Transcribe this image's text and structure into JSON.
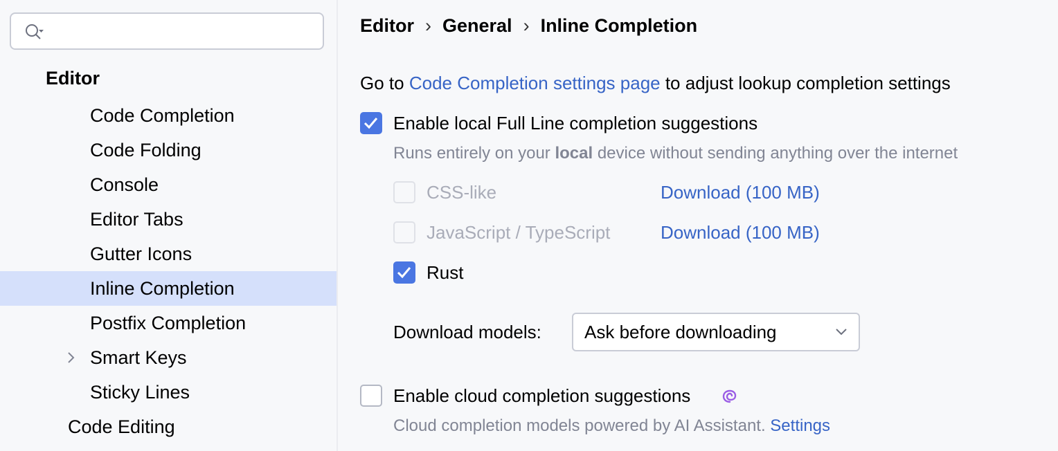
{
  "sidebar": {
    "search": {
      "value": "",
      "placeholder": ""
    },
    "section": "Editor",
    "items": [
      {
        "label": "Code Completion"
      },
      {
        "label": "Code Folding"
      },
      {
        "label": "Console"
      },
      {
        "label": "Editor Tabs"
      },
      {
        "label": "Gutter Icons"
      },
      {
        "label": "Inline Completion",
        "selected": true
      },
      {
        "label": "Postfix Completion"
      },
      {
        "label": "Smart Keys",
        "expandable": true
      },
      {
        "label": "Sticky Lines"
      }
    ],
    "next_section": "Code Editing"
  },
  "breadcrumb": {
    "items": [
      "Editor",
      "General",
      "Inline Completion"
    ],
    "separator": "›"
  },
  "main": {
    "goto_prefix": "Go to ",
    "goto_link": "Code Completion settings page",
    "goto_suffix": " to adjust lookup completion settings",
    "local": {
      "label": "Enable local Full Line completion suggestions",
      "checked": true,
      "hint_prefix": "Runs entirely on your ",
      "hint_bold": "local",
      "hint_suffix": " device without sending anything over the internet",
      "languages": [
        {
          "label": "CSS-like",
          "checked": false,
          "enabled": false,
          "download": "Download (100 MB)"
        },
        {
          "label": "JavaScript / TypeScript",
          "checked": false,
          "enabled": false,
          "download": "Download (100 MB)"
        },
        {
          "label": "Rust",
          "checked": true,
          "enabled": true
        }
      ],
      "download_models_label": "Download models:",
      "download_models_value": "Ask before downloading"
    },
    "cloud": {
      "label": "Enable cloud completion suggestions",
      "checked": false,
      "icon": "ai-assistant-spiral-icon",
      "hint": "Cloud completion models powered by AI Assistant.",
      "hint_link": "Settings"
    }
  },
  "colors": {
    "accent": "#4a76e2",
    "link": "#3764c6",
    "selection": "#d5e0fb",
    "ai_icon": "#9b5de5"
  }
}
